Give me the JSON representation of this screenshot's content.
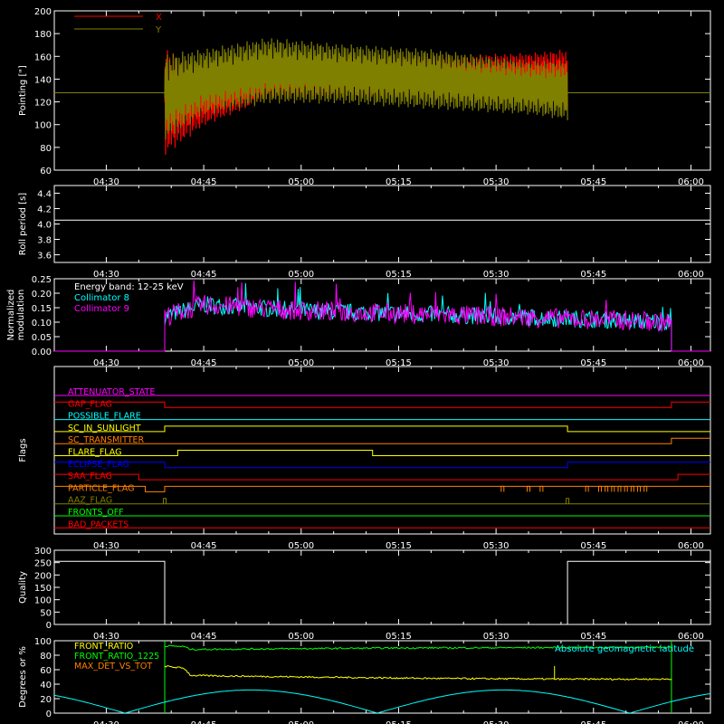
{
  "time_ticks": [
    "04:30",
    "04:45",
    "05:00",
    "05:15",
    "05:30",
    "05:45",
    "06:00"
  ],
  "chart_data": [
    {
      "type": "line",
      "ylabel": "Pointing [\"]",
      "ylim": [
        60,
        200
      ],
      "yticks": [
        60,
        80,
        100,
        120,
        140,
        160,
        180,
        200
      ],
      "legend": [
        {
          "name": "X",
          "color": "#ff0000"
        },
        {
          "name": "Y",
          "color": "#808000"
        }
      ],
      "series": [
        {
          "name": "X",
          "color": "#ff0000",
          "t_start": "04:39",
          "t_end": "05:41",
          "x": [
            "04:39",
            "04:45",
            "04:55",
            "05:05",
            "05:20",
            "05:35",
            "05:41"
          ],
          "upper": [
            165,
            150,
            155,
            158,
            160,
            162,
            165
          ],
          "lower": [
            75,
            100,
            123,
            125,
            125,
            120,
            115
          ],
          "flat_value": 128
        },
        {
          "name": "Y",
          "color": "#808000",
          "t_start": "04:39",
          "t_end": "05:41",
          "x": [
            "04:39",
            "04:45",
            "04:55",
            "05:05",
            "05:20",
            "05:35",
            "05:41"
          ],
          "upper": [
            160,
            165,
            175,
            170,
            165,
            155,
            155
          ],
          "lower": [
            88,
            110,
            120,
            120,
            115,
            110,
            105
          ],
          "flat_value": 128
        }
      ]
    },
    {
      "type": "line",
      "ylabel": "Roll period [s]",
      "ylim": [
        3.5,
        4.5
      ],
      "yticks": [
        3.6,
        3.8,
        4.0,
        4.2,
        4.4
      ],
      "series": [
        {
          "name": "",
          "color": "#ffffff",
          "value": 4.05
        }
      ]
    },
    {
      "type": "line",
      "ylabel": "Normalized modulation",
      "ylim": [
        0,
        0.25
      ],
      "yticks": [
        0.0,
        0.05,
        0.1,
        0.15,
        0.2,
        0.25
      ],
      "legend": [
        {
          "name": "Energy band: 12-25 keV",
          "color": "#ffffff"
        },
        {
          "name": "Collimator 8",
          "color": "#00ffff"
        },
        {
          "name": "Collimator 9",
          "color": "#ff00ff"
        }
      ],
      "series": [
        {
          "name": "Collimator 8",
          "color": "#00ffff",
          "t_start": "04:39",
          "t_end": "05:57",
          "x": [
            "04:39",
            "04:45",
            "05:00",
            "05:15",
            "05:30",
            "05:45",
            "05:57"
          ],
          "values": [
            0.12,
            0.16,
            0.14,
            0.13,
            0.12,
            0.11,
            0.1
          ],
          "noise": 0.03
        },
        {
          "name": "Collimator 9",
          "color": "#ff00ff",
          "t_start": "04:39",
          "t_end": "05:57",
          "x": [
            "04:39",
            "04:45",
            "05:00",
            "05:15",
            "05:30",
            "05:45",
            "05:57"
          ],
          "values": [
            0.12,
            0.16,
            0.14,
            0.13,
            0.12,
            0.11,
            0.1
          ],
          "noise": 0.035
        }
      ]
    },
    {
      "type": "line",
      "ylabel": "Flags",
      "flags": [
        {
          "name": "ATTENUATOR_STATE",
          "color": "#ff00ff",
          "transitions": []
        },
        {
          "name": "GAP_FLAG",
          "color": "#ff0000",
          "transitions": [
            "04:39",
            "05:57"
          ],
          "initial": 1
        },
        {
          "name": "POSSIBLE_FLARE",
          "color": "#00ffff",
          "transitions": []
        },
        {
          "name": "SC_IN_SUNLIGHT",
          "color": "#ffff00",
          "transitions": [
            "04:39",
            "05:41"
          ],
          "initial": 0
        },
        {
          "name": "SC_TRANSMITTER",
          "color": "#ff8000",
          "transitions": [
            "05:57"
          ],
          "initial": 0
        },
        {
          "name": "FLARE_FLAG",
          "color": "#ffff00",
          "transitions": [
            "04:41",
            "05:11"
          ],
          "initial": 0
        },
        {
          "name": "ECLIPSE_FLAG",
          "color": "#0000ff",
          "transitions": [
            "04:39",
            "05:41"
          ],
          "initial": 1
        },
        {
          "name": "SAA_FLAG",
          "color": "#ff0000",
          "transitions": [
            "04:35",
            "05:58"
          ],
          "initial": 1
        },
        {
          "name": "PARTICLE_FLAG",
          "color": "#ff8000",
          "transitions": [
            "04:36",
            "04:39"
          ],
          "initial": 1,
          "spikes": [
            "05:31",
            "05:35",
            "05:37",
            "05:44",
            "05:46",
            "05:47",
            "05:48",
            "05:49",
            "05:50",
            "05:51",
            "05:52",
            "05:53"
          ]
        },
        {
          "name": "AAZ_FLAG",
          "color": "#808000",
          "transitions": [],
          "spikes": [
            "04:39",
            "05:41"
          ]
        },
        {
          "name": "FRONTS_OFF",
          "color": "#00ff00",
          "transitions": []
        },
        {
          "name": "BAD_PACKETS",
          "color": "#ff0000",
          "transitions": []
        }
      ]
    },
    {
      "type": "line",
      "ylabel": "Quality",
      "ylim": [
        0,
        300
      ],
      "yticks": [
        0,
        50,
        100,
        150,
        200,
        250,
        300
      ],
      "series": [
        {
          "name": "",
          "color": "#ffffff",
          "x": [
            "04:22",
            "04:39",
            "04:39",
            "05:41",
            "05:41",
            "06:03"
          ],
          "values": [
            255,
            255,
            0,
            0,
            255,
            255
          ]
        }
      ]
    },
    {
      "type": "line",
      "ylabel": "Degrees or %",
      "ylim": [
        0,
        100
      ],
      "yticks": [
        0,
        20,
        40,
        60,
        80,
        100
      ],
      "legend": [
        {
          "name": "FRONT_RATIO",
          "color": "#ffff00"
        },
        {
          "name": "FRONT_RATIO_1225",
          "color": "#00ff00"
        },
        {
          "name": "MAX_DET_VS_TOT",
          "color": "#ff8000"
        }
      ],
      "annotation": {
        "text": "Absolute geomagnetic latitude",
        "color": "#00ffff"
      },
      "series": [
        {
          "name": "FRONT_RATIO",
          "color": "#ffff00",
          "x": [
            "04:39",
            "04:42",
            "04:43",
            "05:00",
            "05:20",
            "05:40",
            "05:57"
          ],
          "values": [
            65,
            62,
            52,
            50,
            48,
            47,
            47
          ]
        },
        {
          "name": "FRONT_RATIO_1225",
          "color": "#00ff00",
          "x": [
            "04:39",
            "04:42",
            "04:43",
            "05:15",
            "05:57"
          ],
          "values": [
            93,
            92,
            88,
            90,
            91
          ]
        },
        {
          "name": "Absolute geomagnetic latitude",
          "color": "#00ffff",
          "x": [
            "04:22",
            "04:28",
            "04:42",
            "05:06",
            "05:28",
            "05:50",
            "06:03"
          ],
          "values": [
            20,
            25,
            0,
            32,
            0,
            30,
            20
          ]
        }
      ]
    }
  ]
}
